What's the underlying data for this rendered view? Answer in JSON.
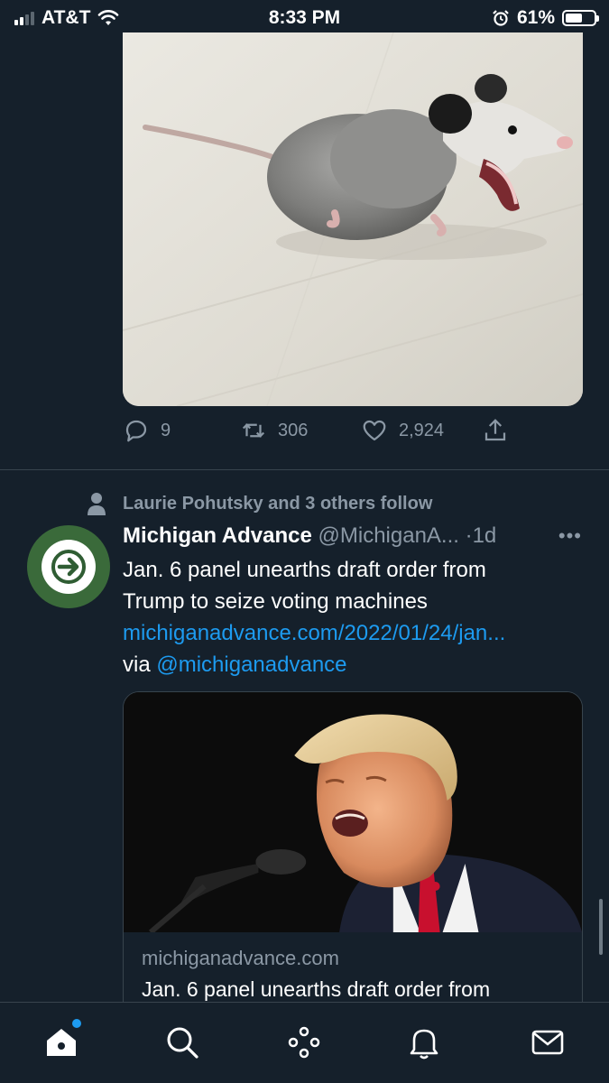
{
  "status_bar": {
    "carrier": "AT&T",
    "time": "8:33 PM",
    "battery": "61%",
    "battery_level": 0.61,
    "signal_bars": 2
  },
  "tweet1": {
    "media_description": "opossum-photo",
    "reply_count": "9",
    "retweet_count": "306",
    "like_count": "2,924"
  },
  "tweet2": {
    "social_context": "Laurie Pohutsky and 3 others follow",
    "name": "Michigan Advance",
    "handle": "@MichiganA...",
    "time": "·1d",
    "more": "•••",
    "text_line1": "Jan. 6 panel unearths draft order from",
    "text_line2": "Trump to seize voting machines",
    "link": "michiganadvance.com/2022/01/24/jan...",
    "via_prefix": "via ",
    "via_mention": "@michiganadvance",
    "card": {
      "domain": "michiganadvance.com",
      "title": "Jan. 6 panel unearths draft order from"
    }
  },
  "nav": {
    "items": [
      "home-icon",
      "search-icon",
      "spaces-icon",
      "notifications-icon",
      "messages-icon"
    ]
  },
  "colors": {
    "background": "#15202b",
    "accent": "#1d9bf0",
    "secondary_text": "#8b98a5",
    "avatar_green": "#3a6a3a"
  }
}
